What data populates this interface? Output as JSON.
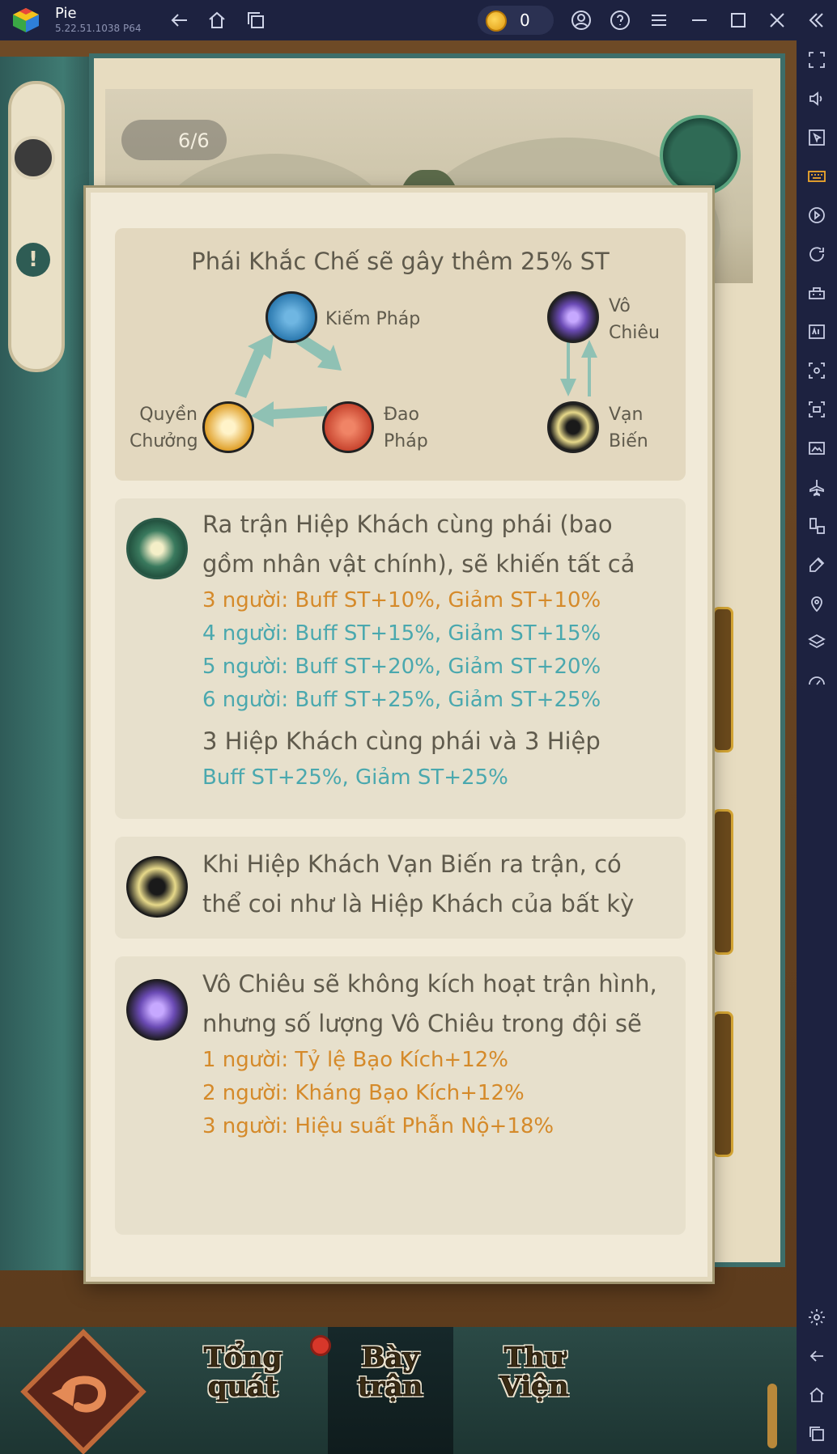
{
  "titlebar": {
    "app_name": "Pie",
    "app_version": "5.22.51.1038  P64",
    "coin_count": "0",
    "icons": [
      "back-icon",
      "home-icon",
      "windows-icon",
      "account-icon",
      "help-icon",
      "menu-icon",
      "minimize-icon",
      "maximize-icon",
      "close-icon",
      "collapse-icon"
    ]
  },
  "sidebar": {
    "icons": [
      "fullscreen-icon",
      "volume-icon",
      "pointer-icon",
      "keyboard-icon",
      "record-icon",
      "rotate-icon",
      "macro-icon",
      "apk-icon",
      "screenshot-icon",
      "screen-record-icon",
      "media-icon",
      "airplane-icon",
      "multi-instance-icon",
      "eco-mode-icon",
      "location-icon",
      "layers-icon",
      "speed-icon",
      "settings-icon",
      "android-back-icon",
      "android-home-icon",
      "recent-apps-icon"
    ]
  },
  "game": {
    "counter": "6/6"
  },
  "type_chart": {
    "title": "Phái Khắc Chế sẽ gây thêm 25% ST",
    "nodes": {
      "kiem": "Kiếm Pháp",
      "dao": [
        "Đao",
        "Pháp"
      ],
      "quyen": [
        "Quyền",
        "Chưởng"
      ],
      "vo": [
        "Vô",
        "Chiêu"
      ],
      "van": [
        "Vạn",
        "Biến"
      ]
    },
    "colors": {
      "kiem": "#3a8fc4",
      "dao": "#c8452f",
      "quyen": "#e0a02a",
      "vo": "#7a58c0",
      "van": "#e7d98a",
      "arrow": "#8fc1b4"
    }
  },
  "cards": [
    {
      "icon": "jade-emblem-icon",
      "lines": [
        {
          "style": "l",
          "text": "Ra trận Hiệp Khách cùng phái (bao"
        },
        {
          "style": "l",
          "text": "gồm nhân vật chính), sẽ khiến tất cả"
        },
        {
          "style": "o",
          "text": "3 người: Buff ST+10%, Giảm ST+10%"
        },
        {
          "style": "b",
          "text": "4 người: Buff ST+15%, Giảm ST+15%"
        },
        {
          "style": "b",
          "text": "5 người: Buff ST+20%, Giảm ST+20%"
        },
        {
          "style": "b",
          "text": "6 người: Buff ST+25%, Giảm ST+25%"
        },
        {
          "style": "l",
          "text": "3 Hiệp Khách cùng phái và 3 Hiệp"
        },
        {
          "style": "b",
          "text": "Buff ST+25%, Giảm ST+25%"
        }
      ]
    },
    {
      "icon": "van-bien-icon",
      "lines": [
        {
          "style": "l",
          "text": "Khi Hiệp Khách Vạn Biến ra trận, có"
        },
        {
          "style": "l",
          "text": "thể coi như là Hiệp Khách của bất kỳ"
        }
      ]
    },
    {
      "icon": "vo-chieu-icon",
      "lines": [
        {
          "style": "l",
          "text": "Vô Chiêu sẽ không kích hoạt trận hình,"
        },
        {
          "style": "l",
          "text": "nhưng số lượng Vô Chiêu trong đội sẽ"
        },
        {
          "style": "o",
          "text": "1 người: Tỷ lệ Bạo Kích+12%"
        },
        {
          "style": "o",
          "text": "2 người: Kháng Bạo Kích+12%"
        },
        {
          "style": "o",
          "text": "3 người: Hiệu suất Phẫn Nộ+18%"
        }
      ]
    }
  ],
  "bottom_nav": {
    "tabs": [
      {
        "line1": "Tổng",
        "line2": "quát"
      },
      {
        "line1": "Bày",
        "line2": "trận"
      },
      {
        "line1": "Thư",
        "line2": "Viện"
      }
    ]
  }
}
